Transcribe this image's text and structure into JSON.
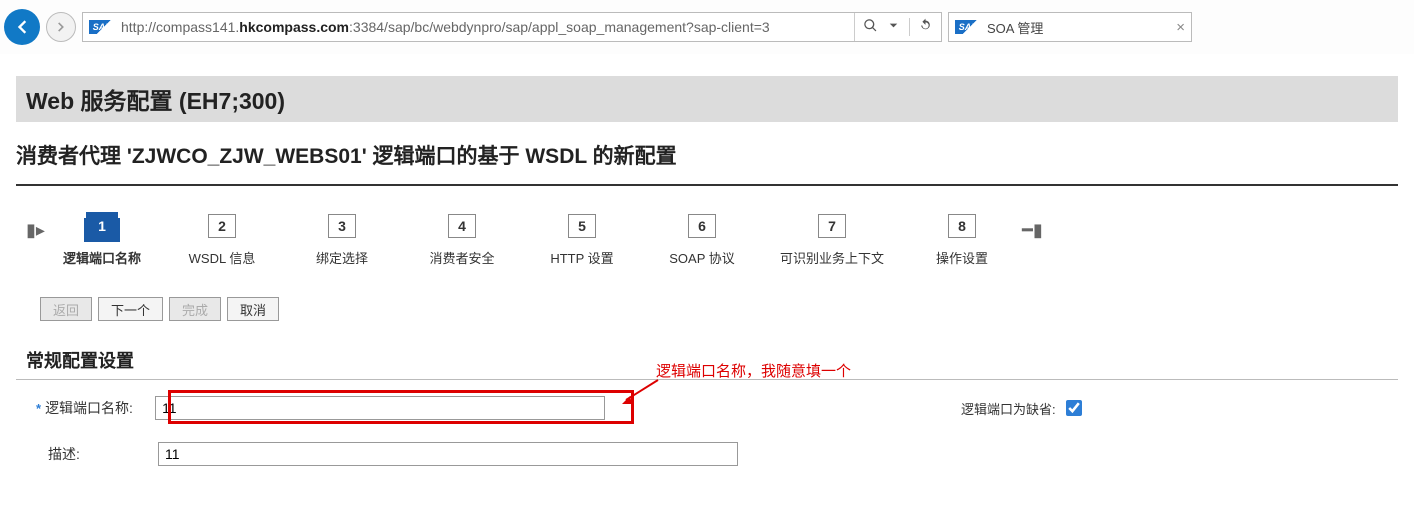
{
  "browser": {
    "url_prefix": "http://compass141.",
    "url_host": "hkcompass.com",
    "url_rest": ":3384/sap/bc/webdynpro/sap/appl_soap_management?sap-client=3",
    "tab_title": "SOA 管理",
    "sap_badge": "SAP"
  },
  "page_title": "Web 服务配置 (EH7;300)",
  "sub_title": "消费者代理 'ZJWCO_ZJW_WEBS01' 逻辑端口的基于 WSDL 的新配置",
  "steps": [
    {
      "num": "1",
      "label": "逻辑端口名称"
    },
    {
      "num": "2",
      "label": "WSDL 信息"
    },
    {
      "num": "3",
      "label": "绑定选择"
    },
    {
      "num": "4",
      "label": "消费者安全"
    },
    {
      "num": "5",
      "label": "HTTP 设置"
    },
    {
      "num": "6",
      "label": "SOAP 协议"
    },
    {
      "num": "7",
      "label": "可识别业务上下文"
    },
    {
      "num": "8",
      "label": "操作设置"
    }
  ],
  "buttons": {
    "back": "返回",
    "next": "下一个",
    "finish": "完成",
    "cancel": "取消"
  },
  "section_title": "常规配置设置",
  "form": {
    "name_label": "逻辑端口名称:",
    "name_value": "11",
    "desc_label": "描述:",
    "desc_value": "11",
    "default_label": "逻辑端口为缺省:"
  },
  "annotation": "逻辑端口名称，我随意填一个"
}
